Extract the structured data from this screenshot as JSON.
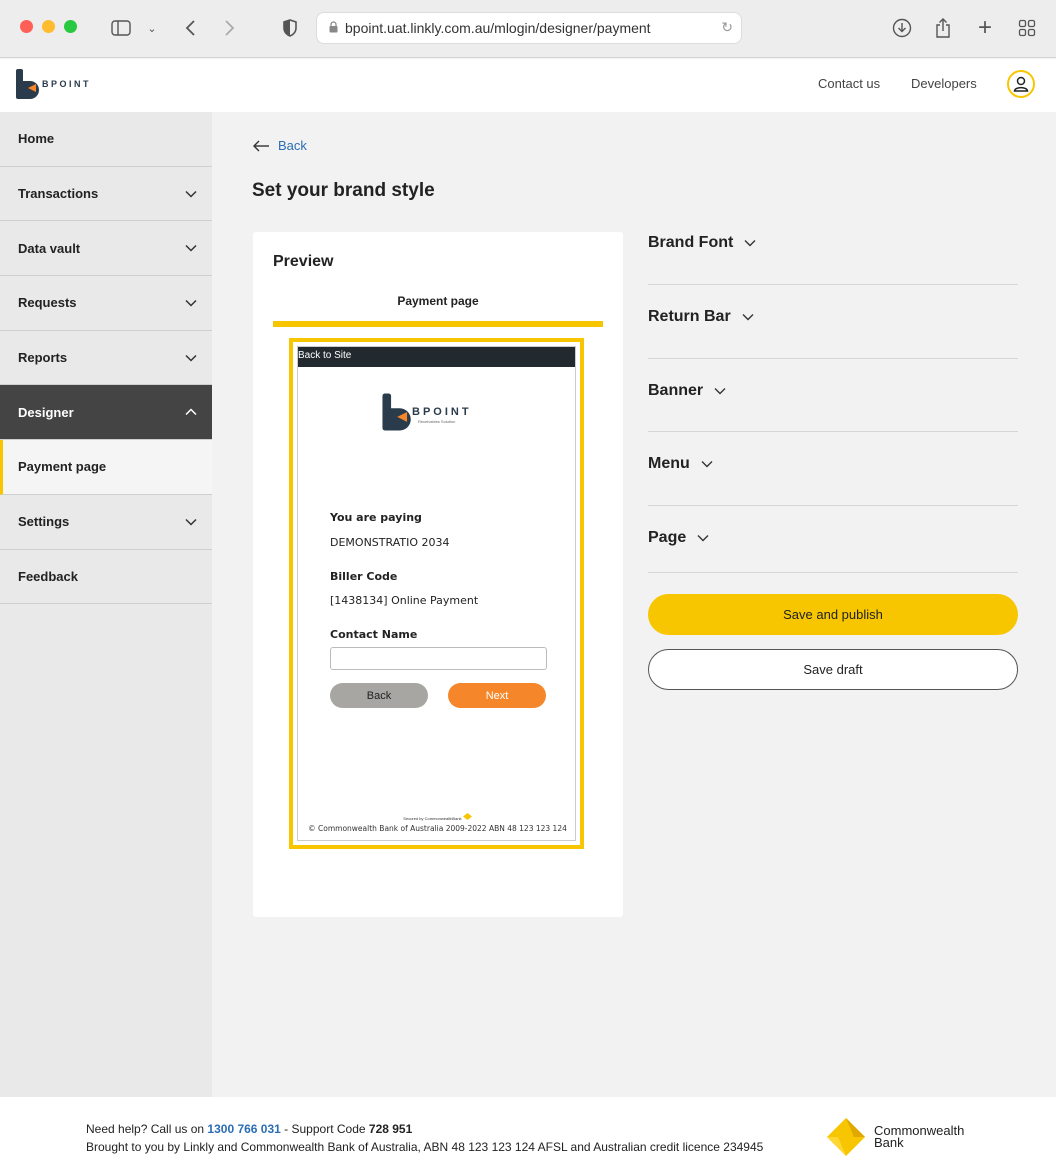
{
  "browser": {
    "url": "bpoint.uat.linkly.com.au/mlogin/designer/payment"
  },
  "header": {
    "logo_text": "BPOINT",
    "links": [
      "Contact us",
      "Developers"
    ]
  },
  "sidebar": {
    "items": [
      {
        "label": "Home"
      },
      {
        "label": "Transactions"
      },
      {
        "label": "Data vault"
      },
      {
        "label": "Requests"
      },
      {
        "label": "Reports"
      },
      {
        "label": "Designer"
      },
      {
        "label": "Payment page"
      },
      {
        "label": "Settings"
      },
      {
        "label": "Feedback"
      }
    ]
  },
  "main": {
    "back_label": "Back",
    "title": "Set your brand style",
    "preview": {
      "title": "Preview",
      "tab_label": "Payment page",
      "mock": {
        "return_bar": "Back to Site",
        "logo_text": "BPOINT",
        "logo_sub": "Receivables Solution",
        "paying_label": "You are paying",
        "paying_value": "DEMONSTRATIO 2034",
        "biller_label": "Biller Code",
        "biller_value": "[1438134] Online Payment",
        "contact_label": "Contact Name",
        "back_button": "Back",
        "next_button": "Next",
        "secured": "Secured by CommonwealthBank",
        "footer": "© Commonwealth Bank of Australia 2009-2022 ABN 48 123 123 124"
      }
    },
    "accordion": [
      {
        "label": "Brand Font"
      },
      {
        "label": "Return Bar"
      },
      {
        "label": "Banner"
      },
      {
        "label": "Menu"
      },
      {
        "label": "Page"
      }
    ],
    "save_publish": "Save and publish",
    "save_draft": "Save draft"
  },
  "footer": {
    "help_prefix": "Need help? Call us on ",
    "phone": "1300 766 031",
    "support_prefix": " - Support Code ",
    "support_code": "728 951",
    "line2": "Brought to you by Linkly and Commonwealth Bank of Australia, ABN 48 123 123 124 AFSL and Australian credit licence 234945",
    "cba_line1": "Commonwealth",
    "cba_line2": "Bank"
  },
  "colors": {
    "accent_yellow": "#f7c600",
    "next_orange": "#f5872a",
    "sidebar_active": "#444444",
    "link_blue": "#2a6db5"
  }
}
